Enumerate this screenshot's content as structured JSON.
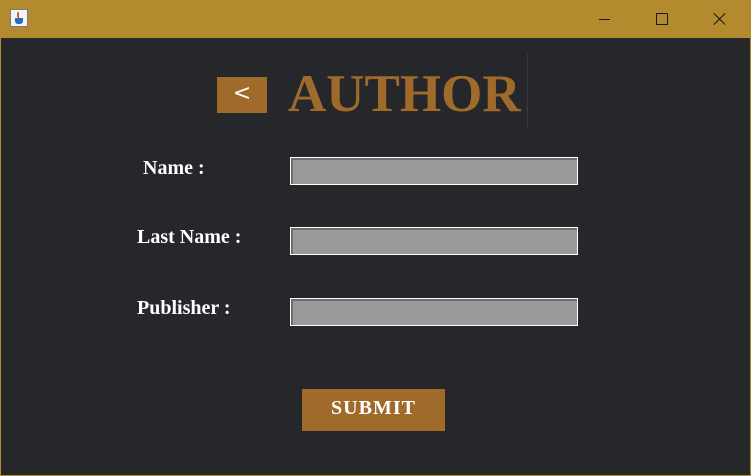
{
  "window": {
    "title": "",
    "icon": "java-cup-icon",
    "controls": {
      "minimize": "minimize-icon",
      "maximize": "maximize-icon",
      "close": "close-icon"
    }
  },
  "colors": {
    "titlebar": "#b38b2e",
    "background": "#26272b",
    "accent": "#a06a2b",
    "field": "#9a9a9a",
    "label_text": "#ffffff"
  },
  "header": {
    "back_label": "<",
    "title": "AUTHOR"
  },
  "form": {
    "fields": [
      {
        "label": "Name :",
        "value": ""
      },
      {
        "label": "Last Name :",
        "value": ""
      },
      {
        "label": "Publisher :",
        "value": ""
      }
    ],
    "submit_label": "SUBMIT"
  }
}
